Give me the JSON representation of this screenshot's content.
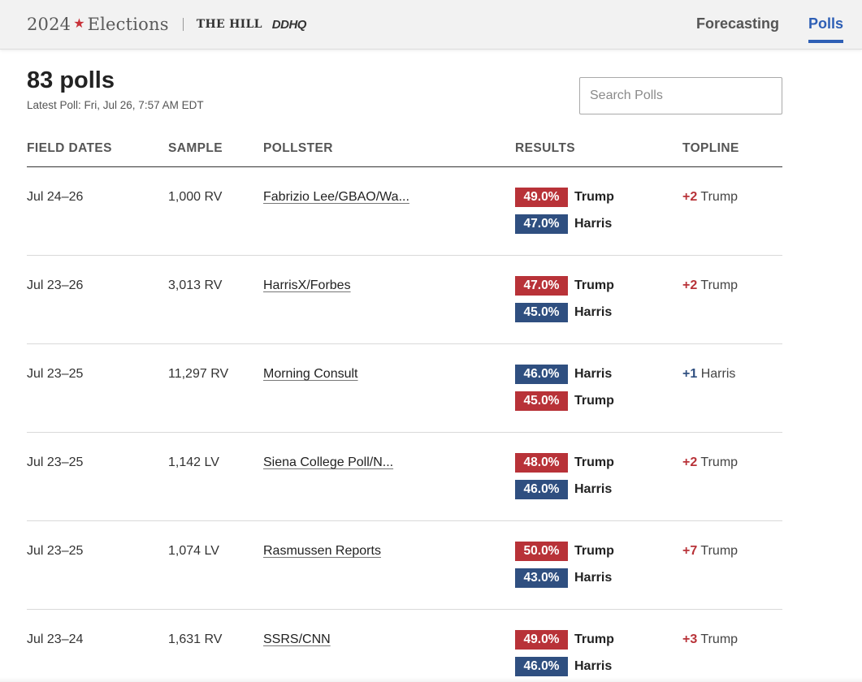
{
  "header": {
    "brand_year": "2024",
    "brand_star": "★",
    "brand_word": "Elections",
    "brand_partner": "THE HILL",
    "brand_ddhq": "DDHQ",
    "nav": [
      {
        "label": "Forecasting",
        "active": false
      },
      {
        "label": "Polls",
        "active": true
      }
    ]
  },
  "summary": {
    "count": "83 polls",
    "latest": "Latest Poll: Fri, Jul 26, 7:57 AM EDT"
  },
  "search": {
    "placeholder": "Search Polls",
    "value": ""
  },
  "table": {
    "columns": [
      "FIELD DATES",
      "SAMPLE",
      "POLLSTER",
      "RESULTS",
      "TOPLINE"
    ],
    "rows": [
      {
        "dates": "Jul 24–26",
        "sample": "1,000 RV",
        "pollster": "Fabrizio Lee/GBAO/Wa...",
        "results": [
          {
            "pct": "49.0%",
            "name": "Trump",
            "party": "rep"
          },
          {
            "pct": "47.0%",
            "name": "Harris",
            "party": "dem"
          }
        ],
        "topline_margin": "+2",
        "topline_name": "Trump",
        "topline_party": "rep"
      },
      {
        "dates": "Jul 23–26",
        "sample": "3,013 RV",
        "pollster": "HarrisX/Forbes",
        "results": [
          {
            "pct": "47.0%",
            "name": "Trump",
            "party": "rep"
          },
          {
            "pct": "45.0%",
            "name": "Harris",
            "party": "dem"
          }
        ],
        "topline_margin": "+2",
        "topline_name": "Trump",
        "topline_party": "rep"
      },
      {
        "dates": "Jul 23–25",
        "sample": "11,297 RV",
        "pollster": "Morning Consult",
        "results": [
          {
            "pct": "46.0%",
            "name": "Harris",
            "party": "dem"
          },
          {
            "pct": "45.0%",
            "name": "Trump",
            "party": "rep"
          }
        ],
        "topline_margin": "+1",
        "topline_name": "Harris",
        "topline_party": "dem"
      },
      {
        "dates": "Jul 23–25",
        "sample": "1,142 LV",
        "pollster": "Siena College Poll/N...",
        "results": [
          {
            "pct": "48.0%",
            "name": "Trump",
            "party": "rep"
          },
          {
            "pct": "46.0%",
            "name": "Harris",
            "party": "dem"
          }
        ],
        "topline_margin": "+2",
        "topline_name": "Trump",
        "topline_party": "rep"
      },
      {
        "dates": "Jul 23–25",
        "sample": "1,074 LV",
        "pollster": "Rasmussen Reports",
        "results": [
          {
            "pct": "50.0%",
            "name": "Trump",
            "party": "rep"
          },
          {
            "pct": "43.0%",
            "name": "Harris",
            "party": "dem"
          }
        ],
        "topline_margin": "+7",
        "topline_name": "Trump",
        "topline_party": "rep"
      },
      {
        "dates": "Jul 23–24",
        "sample": "1,631 RV",
        "pollster": "SSRS/CNN",
        "results": [
          {
            "pct": "49.0%",
            "name": "Trump",
            "party": "rep"
          },
          {
            "pct": "46.0%",
            "name": "Harris",
            "party": "dem"
          }
        ],
        "topline_margin": "+3",
        "topline_name": "Trump",
        "topline_party": "rep"
      }
    ]
  },
  "colors": {
    "rep": "#b83238",
    "dem": "#2f4f80",
    "rep_text": "#b83238",
    "dem_text": "#2f4f80",
    "accent": "#2e5fb5"
  }
}
